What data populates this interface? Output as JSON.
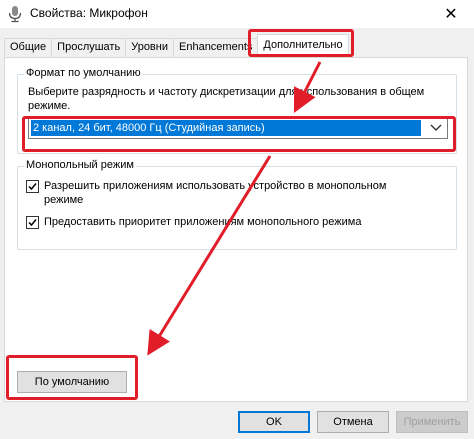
{
  "window": {
    "title": "Свойства: Микрофон",
    "close_glyph": "✕"
  },
  "tabs": [
    {
      "label": "Общие"
    },
    {
      "label": "Прослушать"
    },
    {
      "label": "Уровни"
    },
    {
      "label": "Enhancements"
    },
    {
      "label": "Дополнительно",
      "active": true
    }
  ],
  "default_format": {
    "group_title": "Формат по умолчанию",
    "description": "Выберите разрядность и частоту дискретизации для использования в общем режиме.",
    "selected_value": "2 канал, 24 бит, 48000 Гц (Студийная запись)"
  },
  "exclusive_mode": {
    "group_title": "Монопольный режим",
    "allow_apps_label": "Разрешить приложениям использовать устройство в монопольном режиме",
    "allow_apps_checked": true,
    "priority_label": "Предоставить приоритет приложениям монопольного режима",
    "priority_checked": true
  },
  "restore_default_label": "По умолчанию",
  "footer": {
    "ok_label": "OK",
    "cancel_label": "Отмена",
    "apply_label": "Применить"
  },
  "colors": {
    "annotation": "#e11d2a",
    "selection": "#0078d7"
  },
  "icons": {
    "title": "microphone-icon",
    "close": "close-icon",
    "dropdown": "chevron-down-icon",
    "check": "checkmark-icon"
  }
}
